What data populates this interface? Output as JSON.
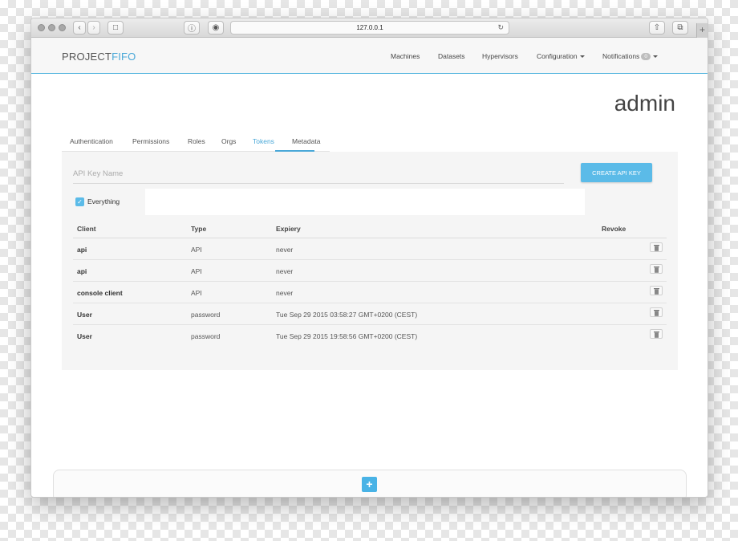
{
  "browser": {
    "url": "127.0.0.1",
    "new_tab": "+"
  },
  "navbar": {
    "logo_part1": "PROJECT",
    "logo_part2": "FIFO",
    "items": [
      {
        "label": "Machines"
      },
      {
        "label": "Datasets"
      },
      {
        "label": "Hypervisors"
      },
      {
        "label": "Configuration"
      },
      {
        "label": "Notifications"
      }
    ],
    "notification_count": "0"
  },
  "page": {
    "title": "admin",
    "tabs": [
      "Authentication",
      "Permissions",
      "Roles",
      "Orgs",
      "Tokens",
      "Metadata"
    ],
    "active_tab": "Tokens"
  },
  "form": {
    "api_key_placeholder": "API Key Name",
    "create_button": "CREATE API KEY",
    "everything_label": "Everything",
    "everything_checked": true
  },
  "table": {
    "headers": [
      "Client",
      "Type",
      "Expiery",
      "Revoke"
    ],
    "rows": [
      {
        "client": "api",
        "type": "API",
        "expiry": "never"
      },
      {
        "client": "api",
        "type": "API",
        "expiry": "never"
      },
      {
        "client": "console client",
        "type": "API",
        "expiry": "never"
      },
      {
        "client": "User",
        "type": "password",
        "expiry": "Tue Sep 29 2015 03:58:27 GMT+0200 (CEST)"
      },
      {
        "client": "User",
        "type": "password",
        "expiry": "Tue Sep 29 2015 19:58:56 GMT+0200 (CEST)"
      }
    ]
  },
  "footer": {
    "add_symbol": "+"
  },
  "colors": {
    "accent": "#4aa8d8",
    "button": "#5bbbe8"
  }
}
